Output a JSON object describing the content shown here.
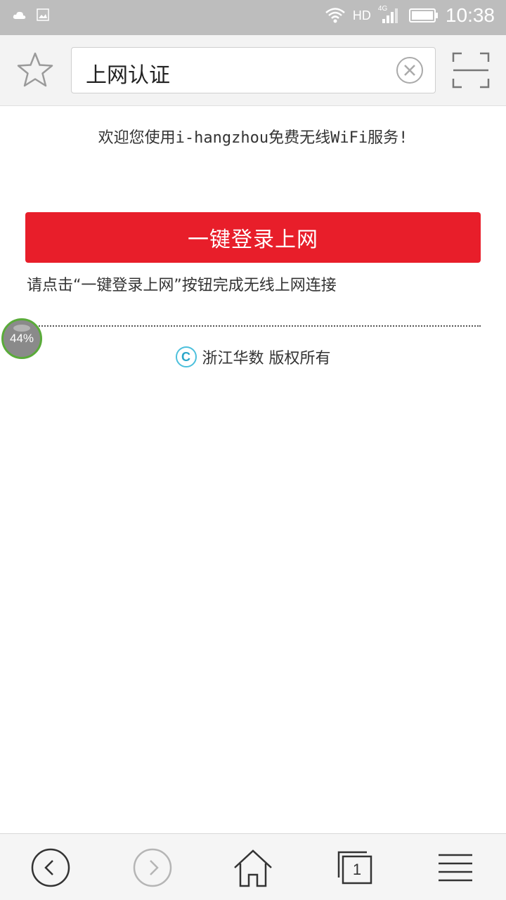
{
  "status_bar": {
    "network": "HD",
    "network_sub": "4G",
    "time": "10:38"
  },
  "toolbar": {
    "url_text": "上网认证",
    "bookmark_icon": "star-icon",
    "clear_icon": "clear-circle-icon",
    "scan_icon": "scan-icon"
  },
  "page": {
    "welcome": "欢迎您使用i-hangzhou免费无线WiFi服务!",
    "login_button": "一键登录上网",
    "hint": "请点击“一键登录上网”按钮完成无线上网连接",
    "copyright_symbol": "C",
    "copyright_text": "浙江华数 版权所有",
    "accent_color": "#e81e2a"
  },
  "progress": {
    "label": "44%",
    "value": 0.44
  },
  "bottom_nav": {
    "back_icon": "back-arrow-icon",
    "forward_icon": "forward-arrow-icon",
    "home_icon": "home-icon",
    "tabs_icon": "tabs-icon",
    "tab_count": "1",
    "menu_icon": "menu-icon"
  }
}
